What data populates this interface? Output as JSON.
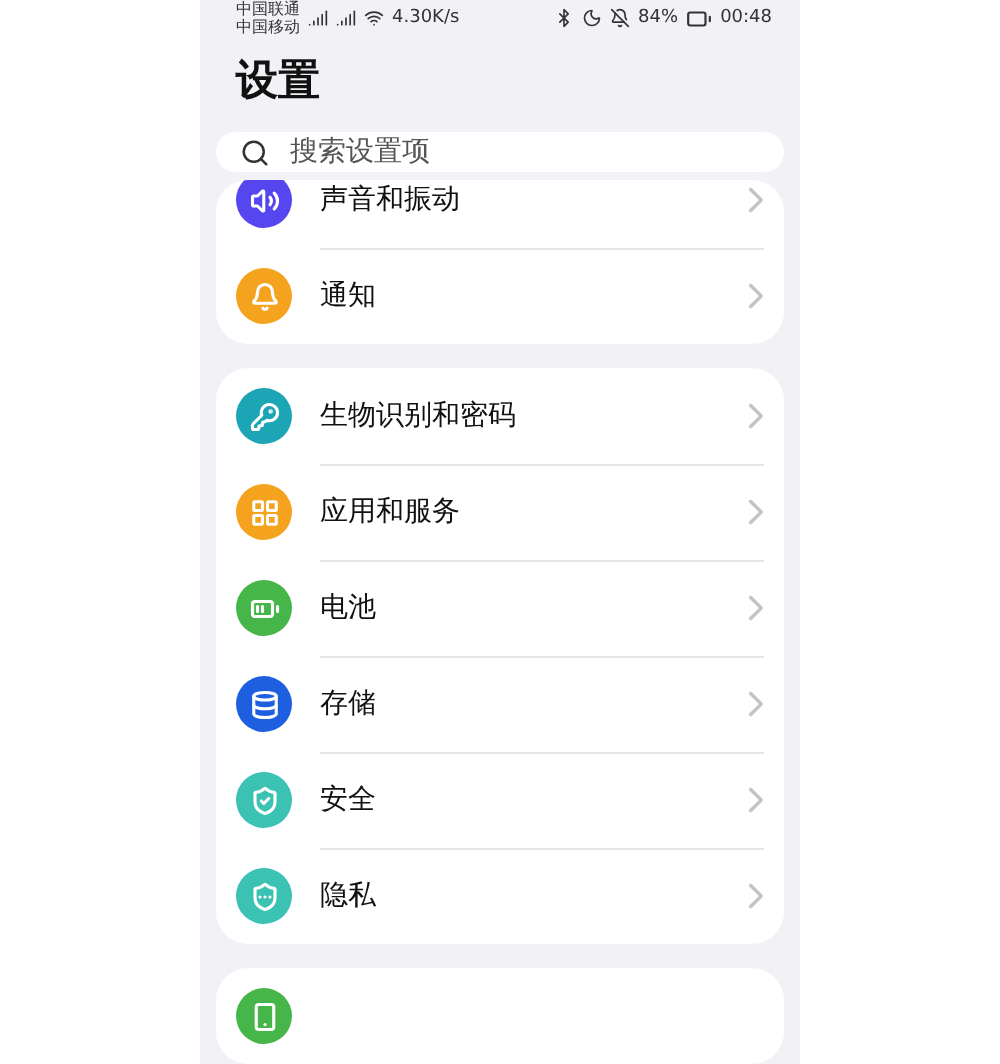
{
  "status_bar": {
    "carriers": [
      "中国联通",
      "中国移动"
    ],
    "speed": "4.30K/s",
    "battery": "84%",
    "time": "00:48"
  },
  "title": "设置",
  "search": {
    "placeholder": "搜索设置项"
  },
  "groups": [
    {
      "items": [
        {
          "label": "声音和振动",
          "kind": "sound",
          "color": "#5546f0"
        },
        {
          "label": "通知",
          "kind": "bell",
          "color": "#f5a21f"
        }
      ]
    },
    {
      "items": [
        {
          "label": "生物识别和密码",
          "kind": "key",
          "color": "#1ca5b5"
        },
        {
          "label": "应用和服务",
          "kind": "apps",
          "color": "#f5a21f"
        },
        {
          "label": "电池",
          "kind": "battery",
          "color": "#47b64a"
        },
        {
          "label": "存储",
          "kind": "storage",
          "color": "#1e5fe0"
        },
        {
          "label": "安全",
          "kind": "shield",
          "color": "#3cc2b2"
        },
        {
          "label": "隐私",
          "kind": "privacy",
          "color": "#3cc2b2"
        }
      ]
    },
    {
      "items": [
        {
          "kind": "phone",
          "color": "#47b64a"
        }
      ]
    }
  ]
}
